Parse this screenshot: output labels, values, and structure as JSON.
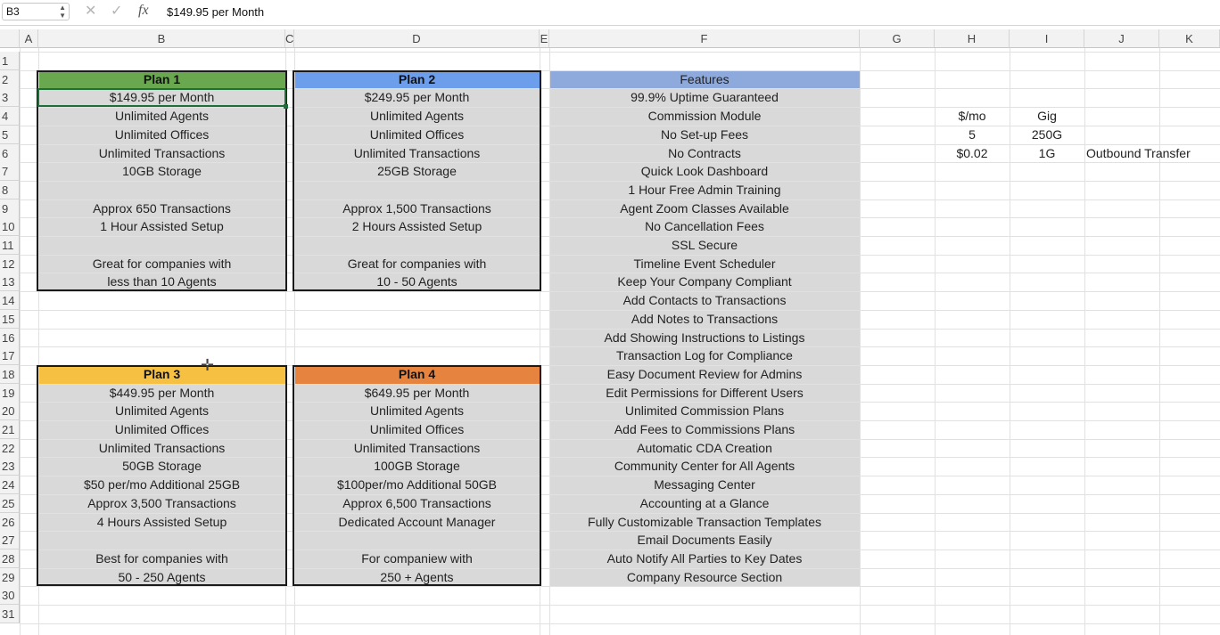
{
  "formula_bar": {
    "name_box": "B3",
    "fx_label": "fx",
    "cancel_glyph": "✕",
    "confirm_glyph": "✓",
    "formula_value": "$149.95 per Month"
  },
  "columns": [
    "A",
    "B",
    "C",
    "D",
    "E",
    "F",
    "G",
    "H",
    "I",
    "J",
    "K"
  ],
  "rows": [
    "1",
    "2",
    "3",
    "4",
    "5",
    "6",
    "7",
    "8",
    "9",
    "10",
    "11",
    "12",
    "13",
    "14",
    "15",
    "16",
    "17",
    "18",
    "19",
    "20",
    "21",
    "22",
    "23",
    "24",
    "25",
    "26",
    "27",
    "28",
    "29",
    "30",
    "31"
  ],
  "plans": [
    {
      "header": "Plan 1",
      "color": "#6aa84f",
      "lines": [
        "$149.95 per Month",
        "Unlimited Agents",
        "Unlimited Offices",
        "Unlimited Transactions",
        "10GB Storage",
        "",
        "Approx 650 Transactions",
        "1 Hour Assisted Setup",
        "",
        "Great for companies with",
        "less than 10 Agents"
      ]
    },
    {
      "header": "Plan 2",
      "color": "#6d9eeb",
      "lines": [
        "$249.95 per Month",
        "Unlimited Agents",
        "Unlimited Offices",
        "Unlimited Transactions",
        "25GB Storage",
        "",
        "Approx 1,500 Transactions",
        "2 Hours Assisted Setup",
        "",
        "Great for companies with",
        "10 - 50 Agents"
      ]
    },
    {
      "header": "Plan 3",
      "color": "#f6c142",
      "lines": [
        "$449.95 per Month",
        "Unlimited Agents",
        "Unlimited Offices",
        "Unlimited Transactions",
        "50GB Storage",
        "$50 per/mo Additional 25GB",
        "Approx 3,500 Transactions",
        "4 Hours Assisted Setup",
        "",
        "Best for companies with",
        "50 - 250 Agents"
      ]
    },
    {
      "header": "Plan 4",
      "color": "#e6843f",
      "lines": [
        "$649.95 per Month",
        "Unlimited Agents",
        "Unlimited Offices",
        "Unlimited Transactions",
        "100GB Storage",
        "$100per/mo Additional 50GB",
        "Approx 6,500 Transactions",
        "Dedicated Account Manager",
        "",
        "For companiew with",
        "250 + Agents"
      ]
    }
  ],
  "features": {
    "header": "Features",
    "header_color": "#8ea9db",
    "items": [
      "99.9% Uptime Guaranteed",
      "Commission Module",
      "No Set-up Fees",
      "No Contracts",
      "Quick Look Dashboard",
      "1 Hour Free Admin Training",
      "Agent Zoom Classes Available",
      "No Cancellation Fees",
      "SSL Secure",
      "Timeline Event Scheduler",
      "Keep Your Company Compliant",
      "Add Contacts to Transactions",
      "Add Notes to Transactions",
      "Add Showing Instructions to Listings",
      "Transaction Log for Compliance",
      "Easy Document Review for Admins",
      "Edit Permissions for Different Users",
      "Unlimited Commission Plans",
      "Add Fees to Commissions Plans",
      "Automatic CDA Creation",
      "Community Center for All Agents",
      "Messaging Center",
      "Accounting at a Glance",
      "Fully Customizable Transaction Templates",
      "Email Documents Easily",
      "Auto Notify All Parties to Key Dates",
      "Company Resource Section"
    ]
  },
  "side_table": {
    "h4": "$/mo",
    "i4": "Gig",
    "h5": "5",
    "i5": "250G",
    "h6": "$0.02",
    "i6": "1G",
    "j6": "Outbound Transfer"
  },
  "colors": {
    "cell_fill": "#d9d9d9",
    "selection": "#1f6e3a",
    "grid": "#e1e1e1"
  }
}
